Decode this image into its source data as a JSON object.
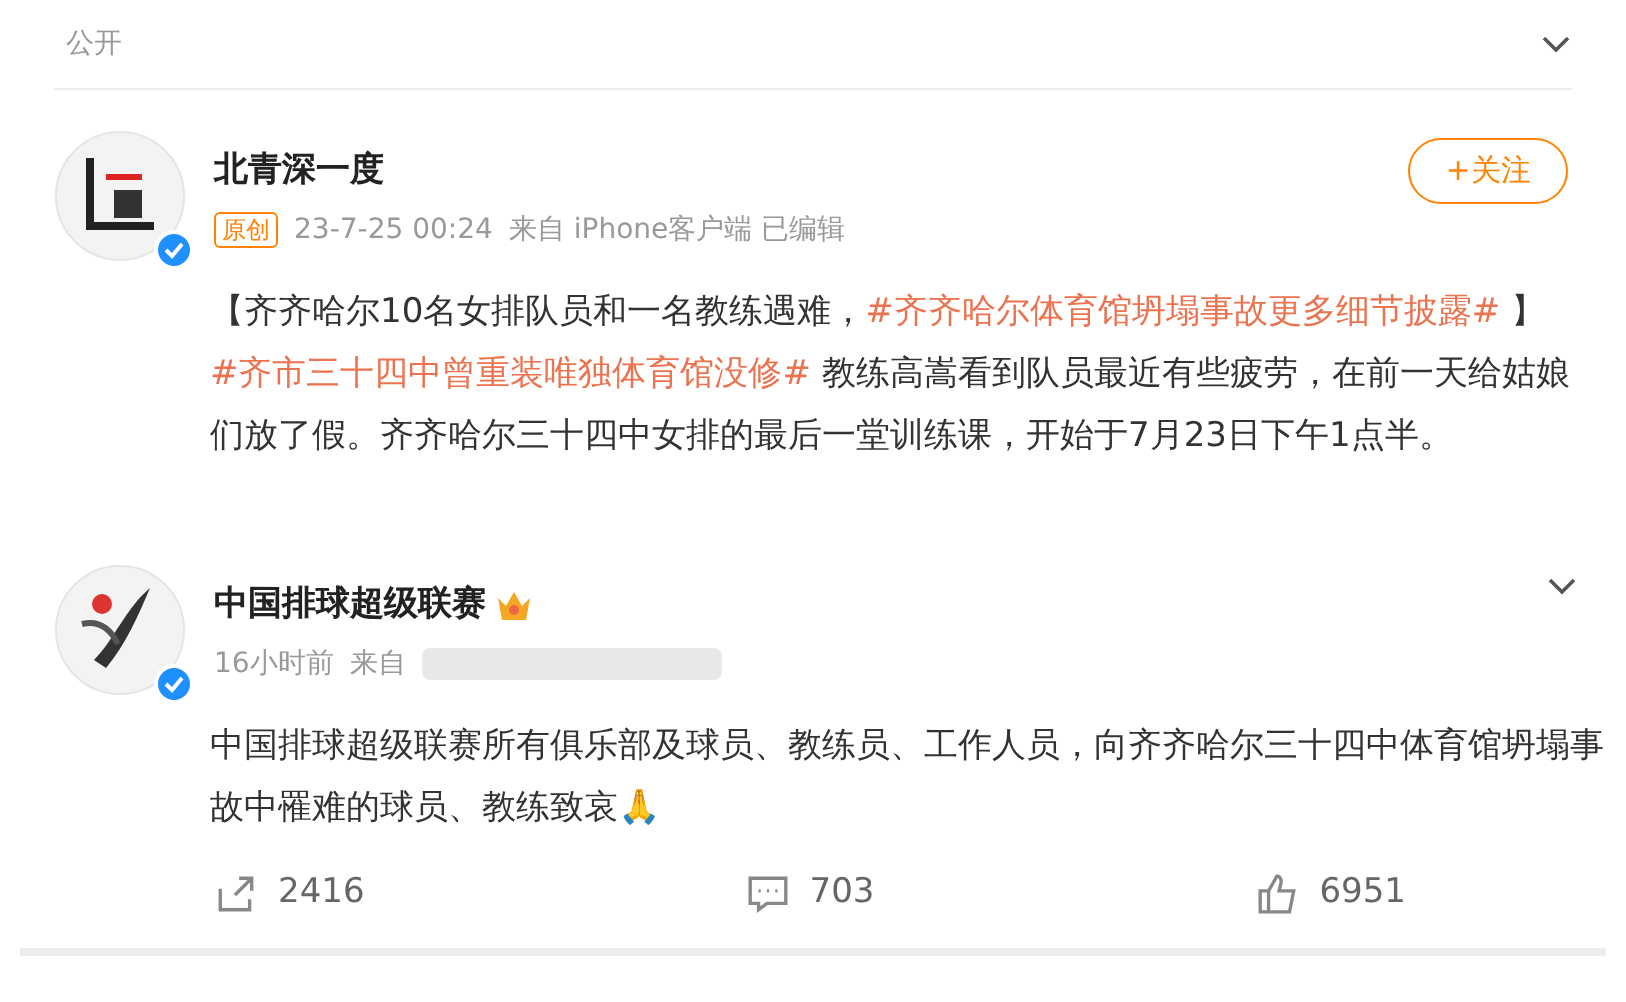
{
  "header": {
    "visibility": "公开"
  },
  "posts": [
    {
      "author": "北青深一度",
      "badge": "原创",
      "time": "23-7-25 00:24",
      "source": "来自 iPhone客户端 已编辑",
      "follow_button": "+关注",
      "content": [
        {
          "kind": "text",
          "text": "【齐齐哈尔10名女排队员和一名教练遇难，"
        },
        {
          "kind": "topic",
          "text": "#齐齐哈尔体育馆坍塌事故更多细节披露#"
        },
        {
          "kind": "text",
          "text": " 】"
        },
        {
          "kind": "topic",
          "text": "#齐市三十四中曾重装唯独体育馆没修#"
        },
        {
          "kind": "text",
          "text": " 教练高嵩看到队员最近有些疲劳，在前一天给姑娘们放了假。齐齐哈尔三十四中女排的最后一堂训练课，开始于7月23日下午1点半。"
        }
      ]
    },
    {
      "author": "中国排球超级联赛",
      "crown": true,
      "time": "16小时前",
      "source": "来自",
      "source_blurred": true,
      "content": [
        {
          "kind": "text",
          "text": "中国排球超级联赛所有俱乐部及球员、教练员、工作人员，向齐齐哈尔三十四中体育馆坍塌事故中罹难的球员、教练致哀🙏"
        }
      ],
      "actions": [
        {
          "kind": "repost",
          "count": "2416"
        },
        {
          "kind": "comment",
          "count": "703"
        },
        {
          "kind": "like",
          "count": "6951"
        }
      ]
    }
  ]
}
